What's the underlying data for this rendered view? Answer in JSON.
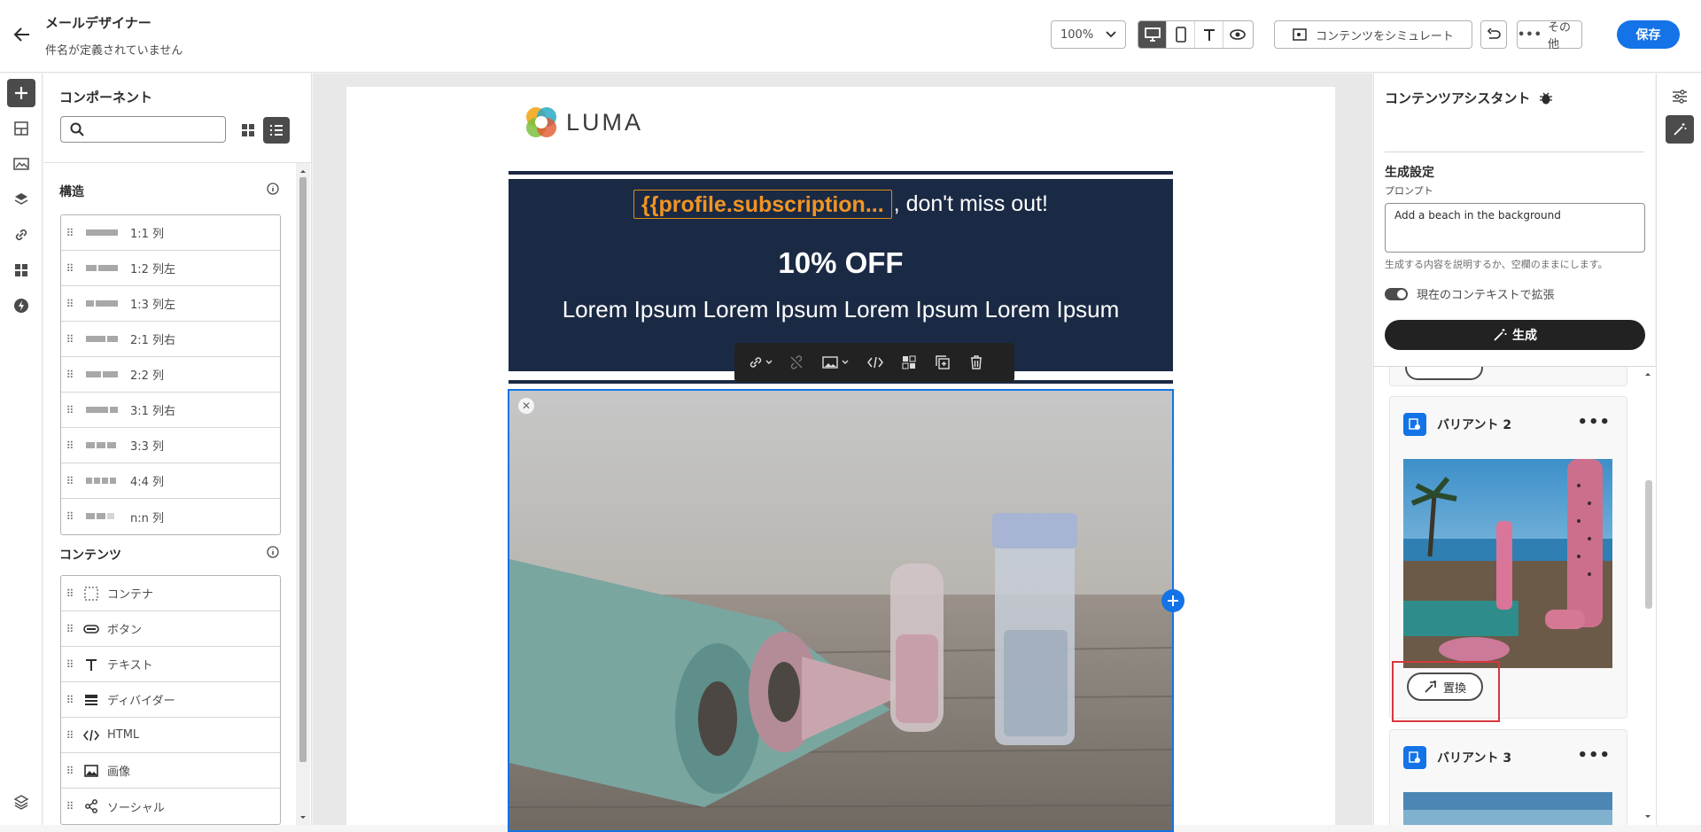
{
  "header": {
    "title": "メールデザイナー",
    "subtitle": "件名が定義されていません",
    "zoom": "100%",
    "simulate_label": "コンテンツをシミュレート",
    "more_label": "その他",
    "save_label": "保存"
  },
  "left_panel": {
    "title": "コンポーネント",
    "search_placeholder": "",
    "structure_heading": "構造",
    "structure_items": [
      "1:1 列",
      "1:2 列左",
      "1:3 列左",
      "2:1 列右",
      "2:2 列",
      "3:1 列右",
      "3:3 列",
      "4:4 列",
      "n:n 列"
    ],
    "content_heading": "コンテンツ",
    "content_items": [
      {
        "label": "コンテナ",
        "icon": "container-icon"
      },
      {
        "label": "ボタン",
        "icon": "button-icon"
      },
      {
        "label": "テキスト",
        "icon": "text-icon"
      },
      {
        "label": "ディバイダー",
        "icon": "divider-icon"
      },
      {
        "label": "HTML",
        "icon": "code-icon"
      },
      {
        "label": "画像",
        "icon": "image-icon"
      },
      {
        "label": "ソーシャル",
        "icon": "share-icon"
      }
    ]
  },
  "email": {
    "brand": "LUMA",
    "token": "{{profile.subscription...",
    "token_suffix": ", don't miss out!",
    "offer": "10% OFF",
    "lorem": "Lorem Ipsum Lorem Ipsum Lorem Ipsum Lorem Ipsum",
    "banner_color": "#1b2a44",
    "token_color": "#f29423"
  },
  "assistant": {
    "title": "コンテンツアシスタント",
    "gen_settings": "生成設定",
    "prompt_label": "プロンプト",
    "prompt_value": "Add a beach in the background",
    "hint": "生成する内容を説明するか、空欄のままにします。",
    "toggle_label": "現在のコンテキストで拡張",
    "generate_label": "生成",
    "variant2": "バリアント 2",
    "variant3": "バリアント 3",
    "replace_label": "置換"
  },
  "colors": {
    "accent": "#1473e6",
    "highlight": "#d7373f"
  }
}
